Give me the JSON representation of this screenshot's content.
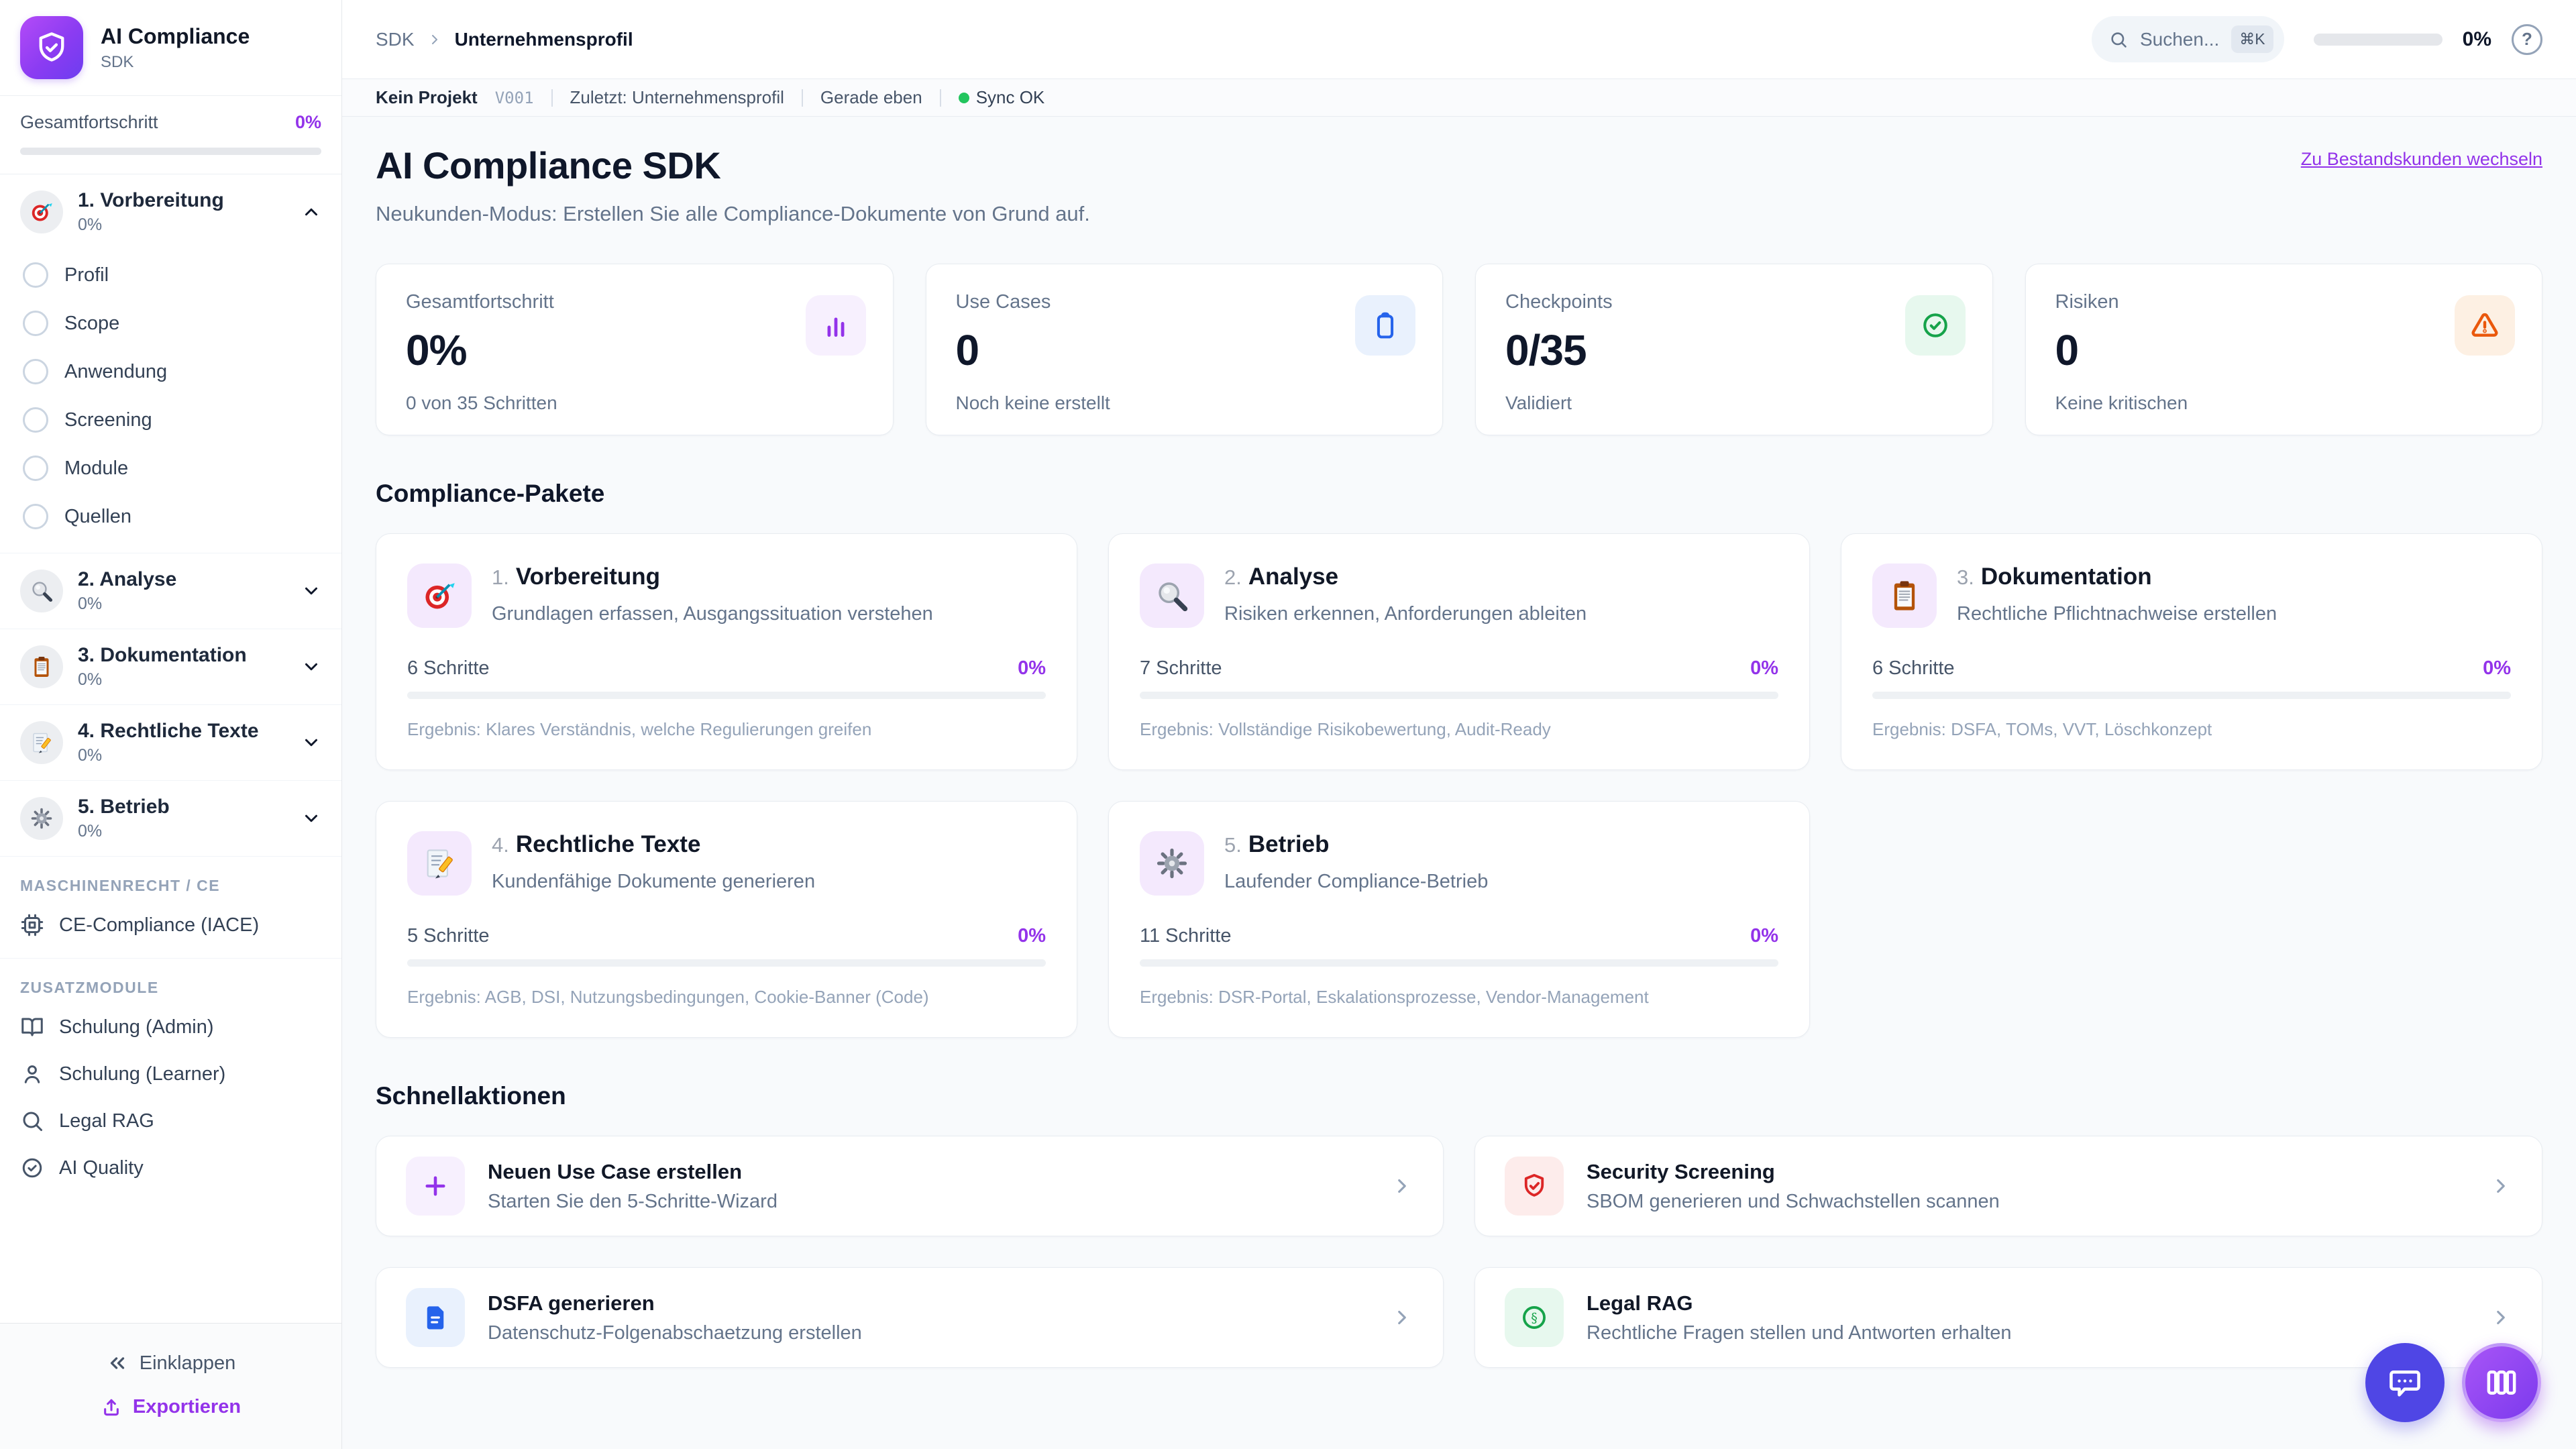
{
  "app": {
    "name": "AI Compliance",
    "subtitle": "SDK"
  },
  "accents": {
    "purple": "#9333ea",
    "indigo": "#4f46e5",
    "blue": "#2563eb",
    "green": "#16a34a",
    "orange": "#ea580c",
    "red": "#dc2626",
    "sync_green": "#22c55e"
  },
  "sidebar": {
    "overall_label": "Gesamtfortschritt",
    "overall_percent": "0%",
    "sections": [
      {
        "label": "1. Vorbereitung",
        "percent": "0%"
      },
      {
        "label": "2. Analyse",
        "percent": "0%"
      },
      {
        "label": "3. Dokumentation",
        "percent": "0%"
      },
      {
        "label": "4. Rechtliche Texte",
        "percent": "0%"
      },
      {
        "label": "5. Betrieb",
        "percent": "0%"
      }
    ],
    "prep_items": [
      "Profil",
      "Scope",
      "Anwendung",
      "Screening",
      "Module",
      "Quellen"
    ],
    "groups": [
      {
        "label": "MASCHINENRECHT / CE",
        "items": [
          "CE-Compliance (IACE)"
        ]
      },
      {
        "label": "ZUSATZMODULE",
        "items": [
          "Schulung (Admin)",
          "Schulung (Learner)",
          "Legal RAG",
          "AI Quality"
        ]
      }
    ],
    "collapse_label": "Einklappen",
    "export_label": "Exportieren"
  },
  "topbar": {
    "breadcrumb": {
      "root": "SDK",
      "current": "Unternehmensprofil"
    },
    "search_placeholder": "Suchen...",
    "shortcut": "⌘K",
    "progress_percent": "0%",
    "help_label": "?"
  },
  "statusbar": {
    "project": "Kein Projekt",
    "version": "V001",
    "last": "Zuletzt: Unternehmensprofil",
    "time": "Gerade eben",
    "sync": "Sync OK"
  },
  "header": {
    "title": "AI Compliance SDK",
    "subtitle": "Neukunden-Modus: Erstellen Sie alle Compliance-Dokumente von Grund auf.",
    "switch_link": "Zu Bestandskunden wechseln"
  },
  "stats": [
    {
      "label": "Gesamtfortschritt",
      "value": "0%",
      "sub": "0 von 35 Schritten",
      "icon": "bar-chart-icon"
    },
    {
      "label": "Use Cases",
      "value": "0",
      "sub": "Noch keine erstellt",
      "icon": "clipboard-icon"
    },
    {
      "label": "Checkpoints",
      "value": "0/35",
      "sub": "Validiert",
      "icon": "check-circle-icon"
    },
    {
      "label": "Risiken",
      "value": "0",
      "sub": "Keine kritischen",
      "icon": "alert-triangle-icon"
    }
  ],
  "packages": {
    "heading": "Compliance-Pakete",
    "cards": [
      {
        "num": "1.",
        "title": "Vorbereitung",
        "desc": "Grundlagen erfassen, Ausgangssituation verstehen",
        "steps": "6 Schritte",
        "percent": "0%",
        "result": "Ergebnis: Klares Verständnis, welche Regulierungen greifen",
        "icon": "target-emoji-icon"
      },
      {
        "num": "2.",
        "title": "Analyse",
        "desc": "Risiken erkennen, Anforderungen ableiten",
        "steps": "7 Schritte",
        "percent": "0%",
        "result": "Ergebnis: Vollständige Risikobewertung, Audit-Ready",
        "icon": "magnifier-emoji-icon"
      },
      {
        "num": "3.",
        "title": "Dokumentation",
        "desc": "Rechtliche Pflichtnachweise erstellen",
        "steps": "6 Schritte",
        "percent": "0%",
        "result": "Ergebnis: DSFA, TOMs, VVT, Löschkonzept",
        "icon": "clipboard-emoji-icon"
      },
      {
        "num": "4.",
        "title": "Rechtliche Texte",
        "desc": "Kundenfähige Dokumente generieren",
        "steps": "5 Schritte",
        "percent": "0%",
        "result": "Ergebnis: AGB, DSI, Nutzungsbedingungen, Cookie-Banner (Code)",
        "icon": "memo-emoji-icon"
      },
      {
        "num": "5.",
        "title": "Betrieb",
        "desc": "Laufender Compliance-Betrieb",
        "steps": "11 Schritte",
        "percent": "0%",
        "result": "Ergebnis: DSR-Portal, Eskalationsprozesse, Vendor-Management",
        "icon": "gear-emoji-icon"
      }
    ]
  },
  "quick": {
    "heading": "Schnellaktionen",
    "actions": [
      {
        "title": "Neuen Use Case erstellen",
        "sub": "Starten Sie den 5-Schritte-Wizard",
        "icon": "plus-icon"
      },
      {
        "title": "Security Screening",
        "sub": "SBOM generieren und Schwachstellen scannen",
        "icon": "shield-check-icon"
      },
      {
        "title": "DSFA generieren",
        "sub": "Datenschutz-Folgenabschaetzung erstellen",
        "icon": "file-text-icon"
      },
      {
        "title": "Legal RAG",
        "sub": "Rechtliche Fragen stellen und Antworten erhalten",
        "icon": "paragraph-circle-icon"
      }
    ]
  },
  "fabs": {
    "chat": "chat-bubble-icon",
    "board": "columns-icon"
  }
}
